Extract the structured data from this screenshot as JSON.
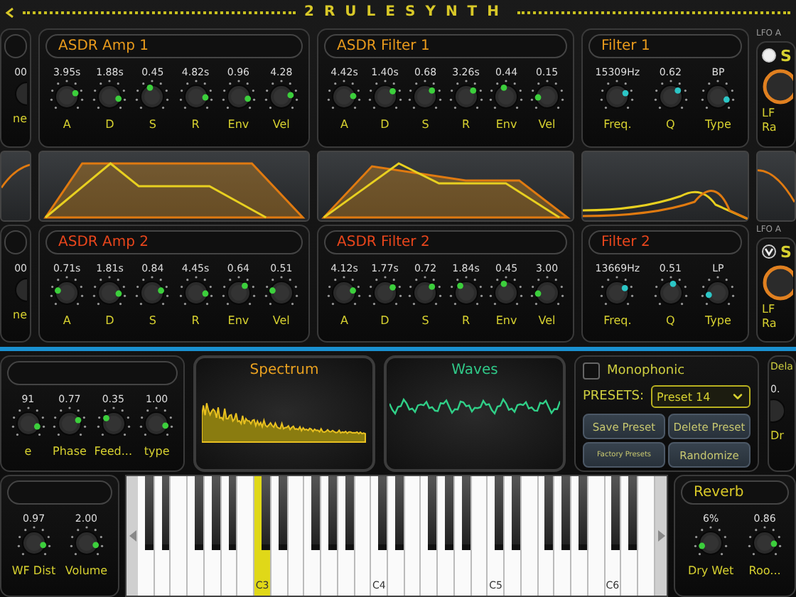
{
  "title": "2RULESYNTH",
  "top_rows": [
    {
      "left_stub": {
        "value": "00",
        "label": "ne"
      },
      "amp": {
        "title": "ASDR Amp 1",
        "color": "#e89a1c",
        "kind": "envelope",
        "knobs": [
          {
            "value": "3.95s",
            "label": "A",
            "level": 0.75
          },
          {
            "value": "1.88s",
            "label": "D",
            "level": 0.88
          },
          {
            "value": "0.45",
            "label": "S",
            "level": 0.45
          },
          {
            "value": "4.82s",
            "label": "R",
            "level": 0.85
          },
          {
            "value": "0.96",
            "label": "Env",
            "level": 0.88
          },
          {
            "value": "4.28",
            "label": "Vel",
            "level": 0.8
          }
        ]
      },
      "filter_env": {
        "title": "ASDR Filter 1",
        "color": "#e89a1c",
        "kind": "envelope",
        "knobs": [
          {
            "value": "4.42s",
            "label": "A",
            "level": 0.82
          },
          {
            "value": "1.40s",
            "label": "D",
            "level": 0.7
          },
          {
            "value": "0.68",
            "label": "S",
            "level": 0.68
          },
          {
            "value": "3.26s",
            "label": "R",
            "level": 0.68
          },
          {
            "value": "0.44",
            "label": "Env",
            "level": 0.45
          },
          {
            "value": "0.15",
            "label": "Vel",
            "level": 0.15
          }
        ]
      },
      "filter": {
        "title": "Filter 1",
        "color": "#e89a1c",
        "kind": "filter",
        "knobs": [
          {
            "value": "15309Hz",
            "label": "Freq.",
            "level": 0.75
          },
          {
            "value": "0.62",
            "label": "Q",
            "level": 0.68
          },
          {
            "value": "BP",
            "label": "Type",
            "level": 0.9
          }
        ]
      },
      "lfo_stub": {
        "header": "LFO A",
        "sync": {
          "label": "S",
          "checked": false
        },
        "labels": [
          "LF",
          "Ra"
        ]
      }
    },
    {
      "left_stub": {
        "value": "00",
        "label": "ne"
      },
      "amp": {
        "title": "ASDR Amp 2",
        "color": "#e8461c",
        "kind": "envelope",
        "knobs": [
          {
            "value": "0.71s",
            "label": "A",
            "level": 0.22
          },
          {
            "value": "1.81s",
            "label": "D",
            "level": 0.85
          },
          {
            "value": "0.84",
            "label": "S",
            "level": 0.78
          },
          {
            "value": "4.45s",
            "label": "R",
            "level": 0.85
          },
          {
            "value": "0.64",
            "label": "Env",
            "level": 0.65
          },
          {
            "value": "0.51",
            "label": "Vel",
            "level": 0.22
          }
        ]
      },
      "filter_env": {
        "title": "ASDR Filter 2",
        "color": "#e8461c",
        "kind": "envelope",
        "knobs": [
          {
            "value": "4.12s",
            "label": "A",
            "level": 0.78
          },
          {
            "value": "1.77s",
            "label": "D",
            "level": 0.7
          },
          {
            "value": "0.72",
            "label": "S",
            "level": 0.68
          },
          {
            "value": "1.84s",
            "label": "R",
            "level": 0.35
          },
          {
            "value": "0.45",
            "label": "Env",
            "level": 0.45
          },
          {
            "value": "3.00",
            "label": "Vel",
            "level": 0.15
          }
        ]
      },
      "filter": {
        "title": "Filter 2",
        "color": "#e8461c",
        "kind": "filter",
        "knobs": [
          {
            "value": "13669Hz",
            "label": "Freq.",
            "level": 0.72
          },
          {
            "value": "0.51",
            "label": "Q",
            "level": 0.55
          },
          {
            "value": "LP",
            "label": "Type",
            "level": 0.12
          }
        ]
      },
      "lfo_stub": {
        "header": "LFO A",
        "sync": {
          "label": "S",
          "checked": true
        },
        "labels": [
          "LF",
          "Ra"
        ]
      }
    }
  ],
  "osc_stub": {
    "knobs": [
      {
        "value": "91",
        "label": "e",
        "level": 0.9
      },
      {
        "value": "0.77",
        "label": "Phase",
        "level": 0.75
      },
      {
        "value": "0.35",
        "label": "Feed...",
        "level": 0.3
      },
      {
        "value": "1.00",
        "label": "type",
        "level": 0.88
      }
    ]
  },
  "spectrum": {
    "title": "Spectrum"
  },
  "waves": {
    "title": "Waves"
  },
  "presets": {
    "monophonic": {
      "label": "Monophonic",
      "checked": false
    },
    "label": "PRESETS:",
    "selected": "Preset 14",
    "buttons": [
      {
        "label": "Save Preset",
        "kind": "normal"
      },
      {
        "label": "Delete Preset",
        "kind": "normal"
      },
      {
        "label": "Factory Presets",
        "kind": "small"
      },
      {
        "label": "Randomize",
        "kind": "normal"
      }
    ]
  },
  "delay_stub": {
    "title": "Dela",
    "value": "0.",
    "label": "Dr"
  },
  "master": {
    "knobs": [
      {
        "value": "0.97",
        "label": "WF Dist",
        "level": 0.88
      },
      {
        "value": "2.00",
        "label": "Volume",
        "level": 0.88
      }
    ]
  },
  "keyboard": {
    "white_keys": [
      {
        "pressed": false
      },
      {
        "pressed": false
      },
      {
        "pressed": false
      },
      {
        "pressed": false
      },
      {
        "pressed": false
      },
      {
        "pressed": false
      },
      {
        "pressed": false
      },
      {
        "label": "C3",
        "pressed": true
      },
      {
        "pressed": false
      },
      {
        "pressed": false
      },
      {
        "pressed": false
      },
      {
        "pressed": false
      },
      {
        "pressed": false
      },
      {
        "pressed": false
      },
      {
        "label": "C4",
        "pressed": false
      },
      {
        "pressed": false
      },
      {
        "pressed": false
      },
      {
        "pressed": false
      },
      {
        "pressed": false
      },
      {
        "pressed": false
      },
      {
        "pressed": false
      },
      {
        "label": "C5",
        "pressed": false
      },
      {
        "pressed": false
      },
      {
        "pressed": false
      },
      {
        "pressed": false
      },
      {
        "pressed": false
      },
      {
        "pressed": false
      },
      {
        "pressed": false
      },
      {
        "label": "C6",
        "pressed": false
      },
      {
        "pressed": false
      },
      {
        "pressed": false
      }
    ]
  },
  "reverb": {
    "title": "Reverb",
    "knobs": [
      {
        "value": "6%",
        "label": "Dry Wet",
        "level": 0.1
      },
      {
        "value": "0.86",
        "label": "Roo...",
        "level": 0.85
      }
    ]
  }
}
